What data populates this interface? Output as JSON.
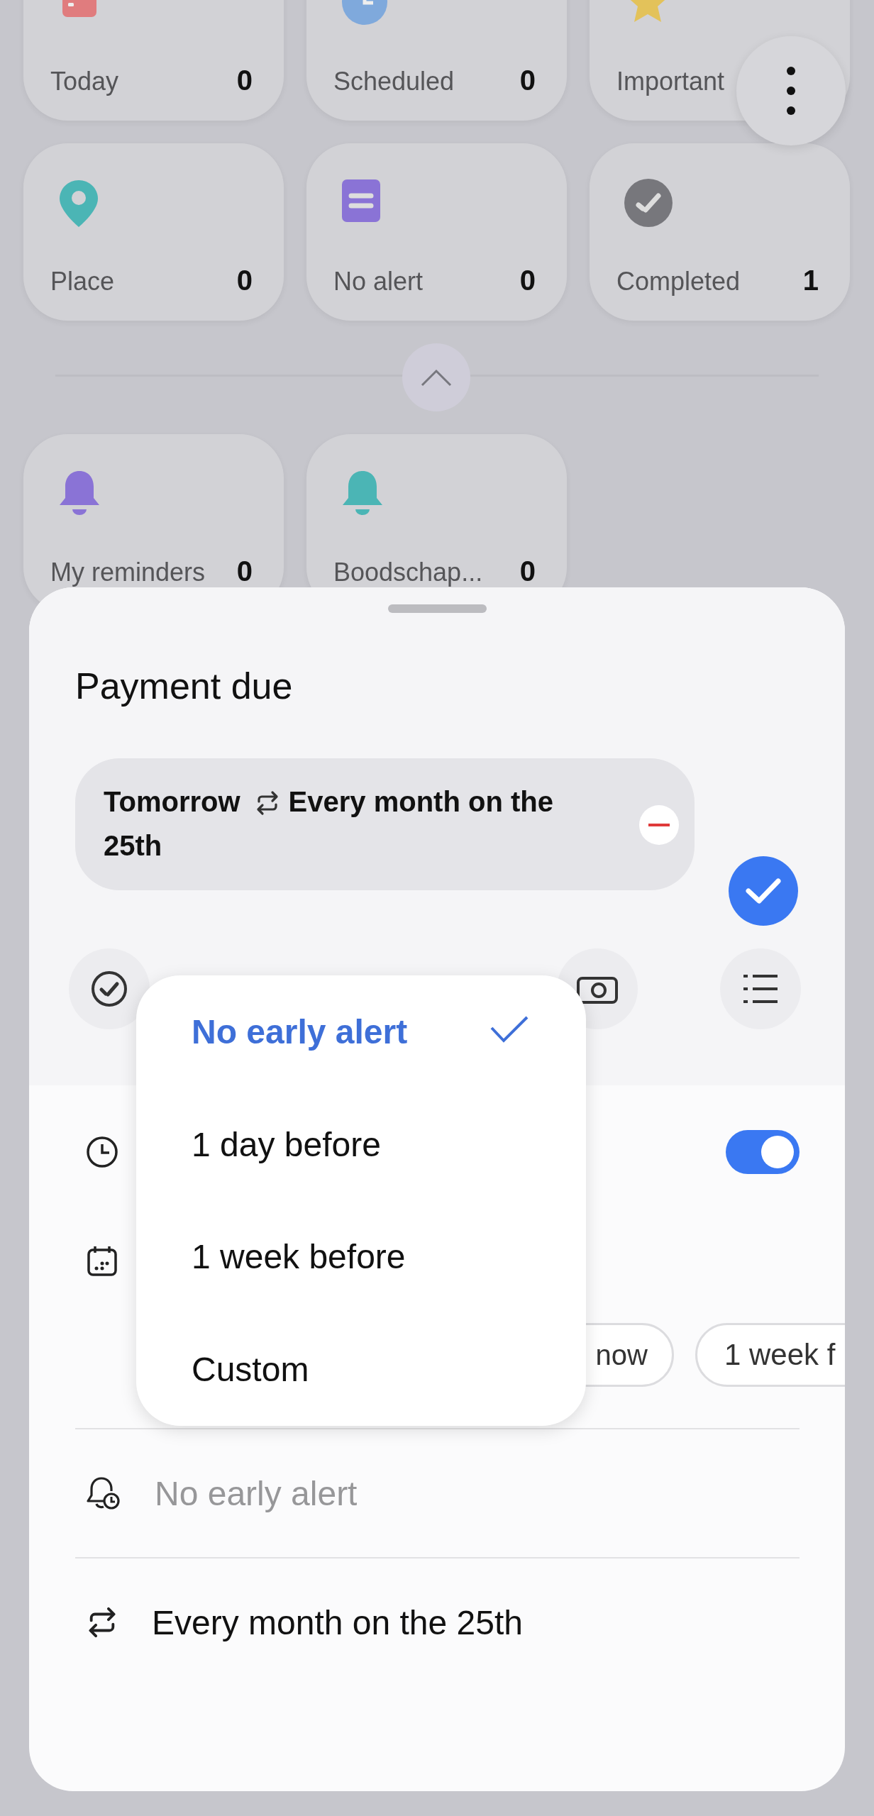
{
  "categories": [
    {
      "kind": "calendar",
      "label": "Today",
      "count": "0",
      "color": "#e07c7e"
    },
    {
      "kind": "clock",
      "label": "Scheduled",
      "count": "0",
      "color": "#7fa9dc"
    },
    {
      "kind": "star",
      "label": "Important",
      "color": "#e3c25a"
    },
    {
      "kind": "pin",
      "label": "Place",
      "count": "0",
      "color": "#4bb5b5"
    },
    {
      "kind": "note",
      "label": "No alert",
      "count": "0",
      "color": "#8a73d6"
    },
    {
      "kind": "done",
      "label": "Completed",
      "count": "1",
      "color": "#77777c"
    }
  ],
  "lists": [
    {
      "label": "My reminders",
      "count": "0",
      "color": "#8a73d6"
    },
    {
      "label": "Boodschap...",
      "count": "0",
      "color": "#4bb5b5"
    }
  ],
  "sheet": {
    "title": "Payment due",
    "schedule": {
      "date": "Tomorrow",
      "repeat": "Every month on the 25th"
    },
    "toolbar": [
      {
        "kind": "check"
      },
      {
        "kind": "camera"
      },
      {
        "kind": "list"
      }
    ],
    "time_row": {
      "on": true
    },
    "quick_chips": [
      "now",
      "1 week f"
    ],
    "early_alert": "No early alert",
    "repeat": "Every month on the 25th"
  },
  "dropdown": {
    "items": [
      {
        "label": "No early alert",
        "selected": true
      },
      {
        "label": "1 day before",
        "selected": false
      },
      {
        "label": "1 week before",
        "selected": false
      },
      {
        "label": "Custom",
        "selected": false
      }
    ]
  }
}
